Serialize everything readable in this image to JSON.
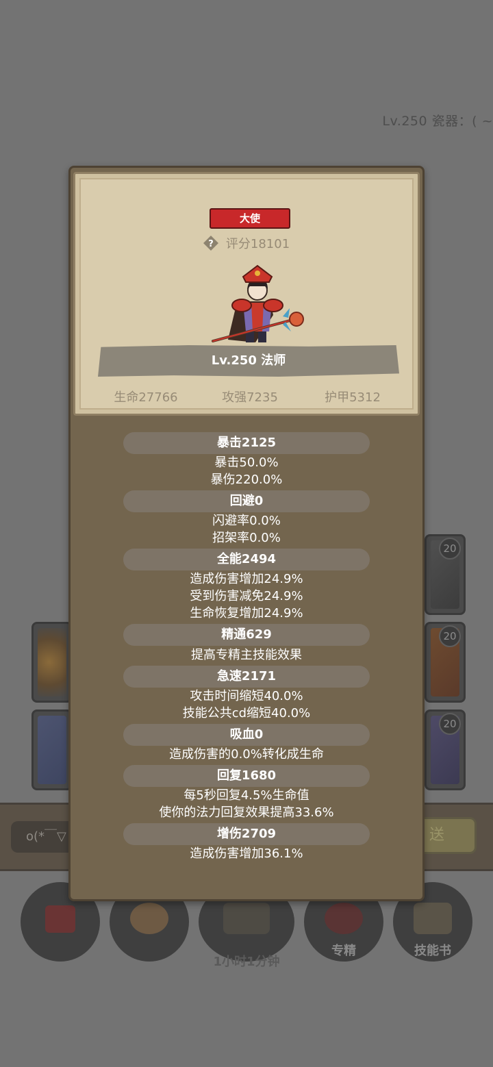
{
  "background": {
    "header_text": "Lv.250 瓷器：( ~",
    "slot_levels": [
      "20",
      "20",
      "20"
    ],
    "chat_input_text": "o(*￣▽",
    "send_button_label": "送",
    "menu": {
      "specialize_label": "专精",
      "skillbook_label": "技能书",
      "chest_timer": "1小时1分钟"
    }
  },
  "hero": {
    "rank": "大使",
    "score": "评分18101",
    "level_class": "Lv.250 法师",
    "hp": "生命27766",
    "attack": "攻强7235",
    "armor": "护甲5312"
  },
  "stats": {
    "crit": {
      "header": "暴击2125",
      "lines": [
        "暴击50.0%",
        "暴伤220.0%"
      ]
    },
    "dodge": {
      "header": "回避0",
      "lines": [
        "闪避率0.0%",
        "招架率0.0%"
      ]
    },
    "versatility": {
      "header": "全能2494",
      "lines": [
        "造成伤害增加24.9%",
        "受到伤害减免24.9%",
        "生命恢复增加24.9%"
      ]
    },
    "mastery": {
      "header": "精通629",
      "lines": [
        "提高专精主技能效果"
      ]
    },
    "haste": {
      "header": "急速2171",
      "lines": [
        "攻击时间缩短40.0%",
        "技能公共cd缩短40.0%"
      ]
    },
    "leech": {
      "header": "吸血0",
      "lines": [
        "造成伤害的0.0%转化成生命"
      ]
    },
    "regen": {
      "header": "回复1680",
      "lines": [
        "每5秒回复4.5%生命值",
        "使你的法力回复效果提高33.6%"
      ]
    },
    "damage": {
      "header": "增伤2709",
      "lines": [
        "造成伤害增加36.1%"
      ]
    }
  },
  "colors": {
    "dim_overlay": "#737373",
    "panel_brown": "#73654e",
    "parchment": "#d9ccad",
    "rank_red": "#c8282a",
    "stat_pill": "#7e7467",
    "text_white": "#ffffff"
  }
}
